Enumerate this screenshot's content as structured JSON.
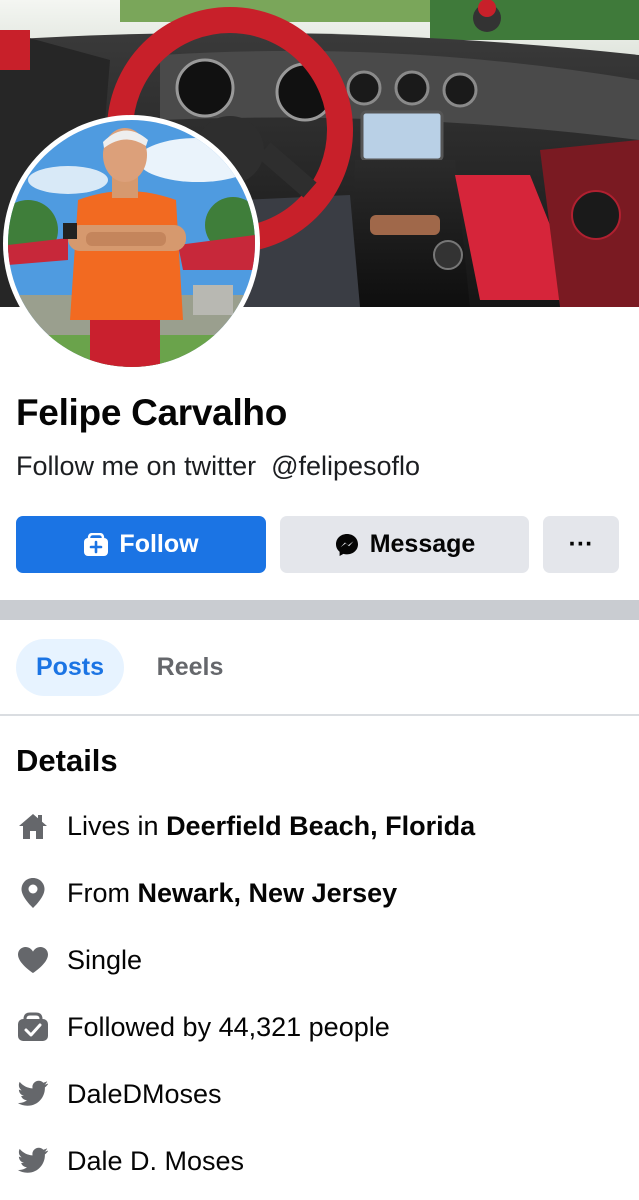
{
  "profile": {
    "name": "Felipe Carvalho",
    "bio": "Follow me on twitter  @felipesoflo"
  },
  "actions": {
    "follow_label": "Follow",
    "message_label": "Message",
    "more_label": "···"
  },
  "tabs": [
    {
      "label": "Posts",
      "active": true
    },
    {
      "label": "Reels",
      "active": false
    }
  ],
  "details": {
    "title": "Details",
    "items": [
      {
        "icon": "home-icon",
        "prefix": "Lives in ",
        "bold": "Deerfield Beach, Florida"
      },
      {
        "icon": "location-pin-icon",
        "prefix": "From ",
        "bold": "Newark, New Jersey"
      },
      {
        "icon": "heart-icon",
        "prefix": "Single",
        "bold": ""
      },
      {
        "icon": "followers-icon",
        "prefix": "Followed by 44,321 people",
        "bold": ""
      },
      {
        "icon": "twitter-icon",
        "prefix": "DaleDMoses",
        "bold": ""
      },
      {
        "icon": "twitter-icon",
        "prefix": "Dale D. Moses",
        "bold": ""
      }
    ]
  },
  "colors": {
    "primary": "#1b74e4",
    "secondary_button": "#e4e6eb",
    "icon_gray": "#65676b",
    "active_tab_bg": "#e7f3ff"
  }
}
